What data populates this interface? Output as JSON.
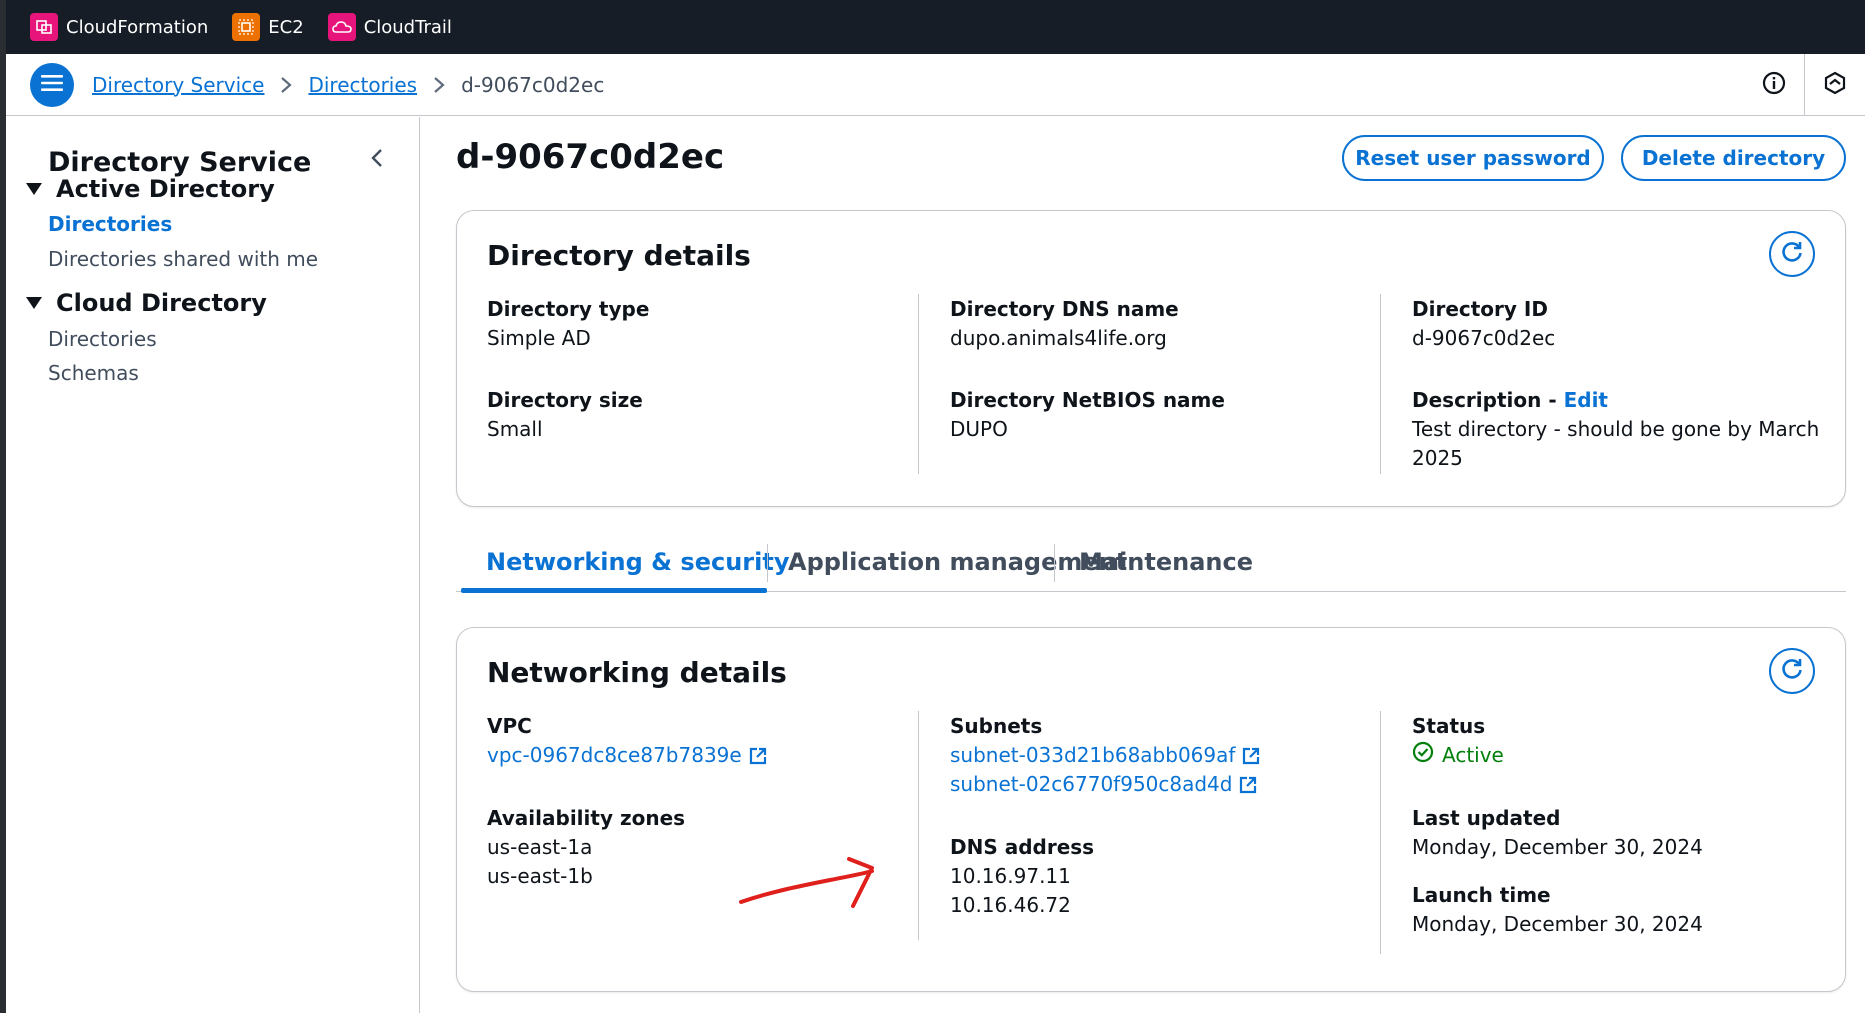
{
  "topbar": {
    "services": [
      {
        "label": "CloudFormation",
        "icon": "cloudformation-icon"
      },
      {
        "label": "EC2",
        "icon": "ec2-icon"
      },
      {
        "label": "CloudTrail",
        "icon": "cloudtrail-icon"
      }
    ]
  },
  "breadcrumb": {
    "items": [
      "Directory Service",
      "Directories",
      "d-9067c0d2ec"
    ]
  },
  "sidebar": {
    "title": "Directory Service",
    "sections": [
      {
        "label": "Active Directory",
        "items": [
          {
            "label": "Directories",
            "active": true
          },
          {
            "label": "Directories shared with me",
            "active": false
          }
        ]
      },
      {
        "label": "Cloud Directory",
        "items": [
          {
            "label": "Directories",
            "active": false
          },
          {
            "label": "Schemas",
            "active": false
          }
        ]
      }
    ]
  },
  "page": {
    "title": "d-9067c0d2ec",
    "reset_button": "Reset user password",
    "delete_button": "Delete directory"
  },
  "directory_details": {
    "title": "Directory details",
    "type_label": "Directory type",
    "type_value": "Simple AD",
    "size_label": "Directory size",
    "size_value": "Small",
    "dns_label": "Directory DNS name",
    "dns_value": "dupo.animals4life.org",
    "netbios_label": "Directory NetBIOS name",
    "netbios_value": "DUPO",
    "id_label": "Directory ID",
    "id_value": "d-9067c0d2ec",
    "desc_label": "Description - ",
    "desc_edit": "Edit",
    "desc_value": "Test directory - should be gone by March 2025"
  },
  "tabs": [
    "Networking & security",
    "Application management",
    "Maintenance"
  ],
  "networking_details": {
    "title": "Networking details",
    "vpc_label": "VPC",
    "vpc_value": "vpc-0967dc8ce87b7839e",
    "az_label": "Availability zones",
    "az_values": [
      "us-east-1a",
      "us-east-1b"
    ],
    "subnets_label": "Subnets",
    "subnets": [
      "subnet-033d21b68abb069af",
      "subnet-02c6770f950c8ad4d"
    ],
    "dns_label": "DNS address",
    "dns_values": [
      "10.16.97.11",
      "10.16.46.72"
    ],
    "status_label": "Status",
    "status_value": "Active",
    "last_updated_label": "Last updated",
    "last_updated_value": "Monday, December 30, 2024",
    "launch_label": "Launch time",
    "launch_value": "Monday, December 30, 2024"
  },
  "colors": {
    "accent": "#0972d3",
    "topbar": "#161d26",
    "success": "#037f0c",
    "annotation": "#e0201c"
  }
}
